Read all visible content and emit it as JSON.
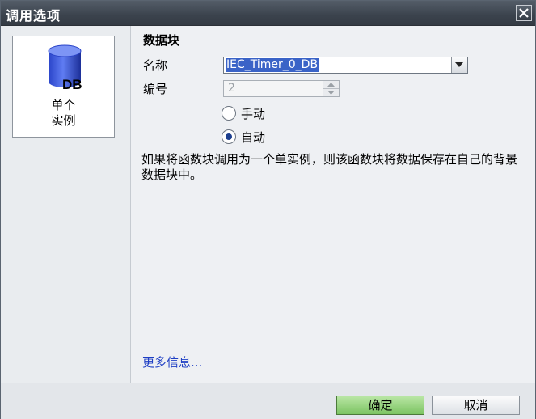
{
  "window": {
    "title": "调用选项"
  },
  "instance_tile": {
    "icon_text": "DB",
    "label_line1": "单个",
    "label_line2": "实例"
  },
  "data_block": {
    "section_title": "数据块",
    "name_label": "名称",
    "name_value": "IEC_Timer_0_DB",
    "number_label": "编号",
    "number_value": "2",
    "radio_manual": "手动",
    "radio_auto": "自动",
    "selected_mode": "自动",
    "description": "如果将函数块调用为一个单实例，则该函数块将数据保存在自己的背景数据块中。",
    "more_info": "更多信息..."
  },
  "buttons": {
    "ok": "确定",
    "cancel": "取消"
  },
  "colors": {
    "titlebar": "#3b434d",
    "ok_button": "#7cc462",
    "selection": "#3a63c7",
    "link": "#1f3fc4"
  }
}
